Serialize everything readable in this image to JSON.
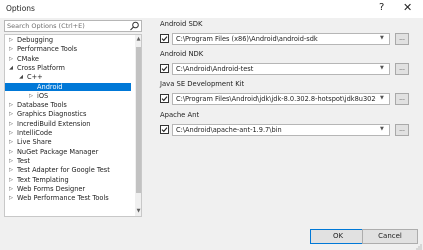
{
  "window": {
    "title": "Options",
    "help": "?",
    "close": "✕"
  },
  "search": {
    "placeholder": "Search Options (Ctrl+E)"
  },
  "tree": {
    "items": [
      {
        "label": "Debugging",
        "expander": "▷"
      },
      {
        "label": "Performance Tools",
        "expander": "▷"
      },
      {
        "label": "CMake",
        "expander": "▷"
      },
      {
        "label": "Cross Platform",
        "expander": "◢"
      },
      {
        "label": "C++",
        "expander": "◢"
      },
      {
        "label": "Android",
        "expander": ""
      },
      {
        "label": "iOS",
        "expander": "▷"
      },
      {
        "label": "Database Tools",
        "expander": "▷"
      },
      {
        "label": "Graphics Diagnostics",
        "expander": "▷"
      },
      {
        "label": "IncrediBuild Extension",
        "expander": "▷"
      },
      {
        "label": "IntelliCode",
        "expander": "▷"
      },
      {
        "label": "Live Share",
        "expander": "▷"
      },
      {
        "label": "NuGet Package Manager",
        "expander": "▷"
      },
      {
        "label": "Test",
        "expander": "▷"
      },
      {
        "label": "Test Adapter for Google Test",
        "expander": "▷"
      },
      {
        "label": "Text Templating",
        "expander": "▷"
      },
      {
        "label": "Web Forms Designer",
        "expander": "▷"
      },
      {
        "label": "Web Performance Test Tools",
        "expander": "▷"
      }
    ],
    "selected_label": "Android"
  },
  "settings": [
    {
      "label": "Android SDK",
      "checked": true,
      "path": "C:\\Program Files (x86)\\Android\\android-sdk",
      "browse": "..."
    },
    {
      "label": "Android NDK",
      "checked": true,
      "path": "C:\\Android\\Android-test",
      "browse": "..."
    },
    {
      "label": "Java SE Development Kit",
      "checked": true,
      "path": "C:\\Program Files\\Android\\jdk\\jdk-8.0.302.8-hotspot\\jdk8u302-b08",
      "browse": "..."
    },
    {
      "label": "Apache Ant",
      "checked": true,
      "path": "C:\\Android\\apache-ant-1.9.7\\bin",
      "browse": "..."
    }
  ],
  "buttons": {
    "ok": "OK",
    "cancel": "Cancel"
  },
  "colors": {
    "selection": "#0078d7",
    "accent_border": "#0078d7"
  }
}
